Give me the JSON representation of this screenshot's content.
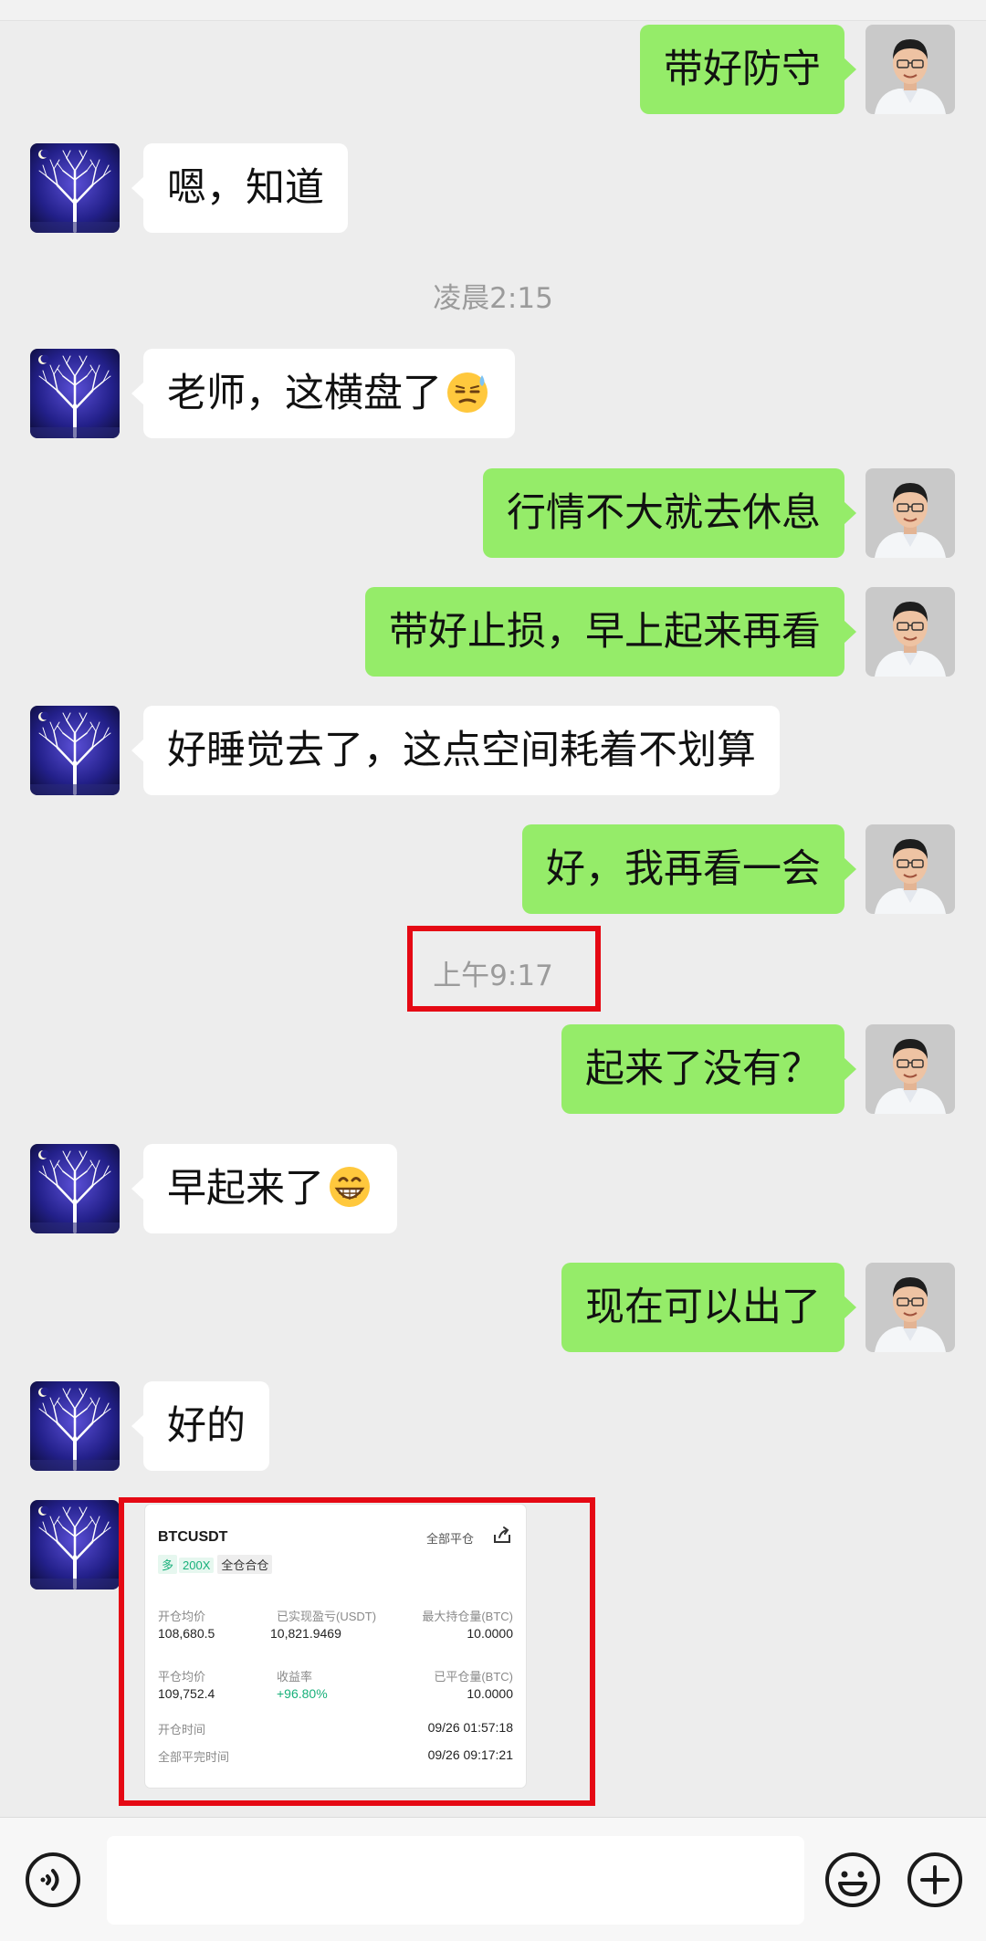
{
  "messages": [
    {
      "side": "right",
      "text": "带好防守"
    },
    {
      "side": "left",
      "text": "嗯，知道"
    },
    {
      "timestamp": "凌晨2:15"
    },
    {
      "side": "left",
      "text": "老师，这横盘了",
      "emoji": "sweat-face-emoji"
    },
    {
      "side": "right",
      "text": "行情不大就去休息"
    },
    {
      "side": "right",
      "text": "带好止损，早上起来再看"
    },
    {
      "side": "left",
      "text": "好睡觉去了，这点空间耗着不划算"
    },
    {
      "side": "right",
      "text": "好，我再看一会"
    },
    {
      "timestamp": "上午9:17"
    },
    {
      "side": "right",
      "text": "起来了没有？"
    },
    {
      "side": "left",
      "text": "早起来了",
      "emoji": "grinning-face-emoji"
    },
    {
      "side": "right",
      "text": "现在可以出了"
    },
    {
      "side": "left",
      "text": "好的"
    }
  ],
  "trade_card": {
    "symbol": "BTCUSDT",
    "close_all": "全部平仓",
    "direction": "多",
    "leverage": "200X",
    "margin_mode": "全仓合仓",
    "open_avg_label": "开仓均价",
    "open_avg_value": "108,680.5",
    "realized_pnl_label": "已实现盈亏(USDT)",
    "realized_pnl_value": "10,821.9469",
    "max_position_label": "最大持仓量(BTC)",
    "max_position_value": "10.0000",
    "close_avg_label": "平仓均价",
    "close_avg_value": "109,752.4",
    "return_label": "收益率",
    "return_value": "+96.80%",
    "closed_qty_label": "已平仓量(BTC)",
    "closed_qty_value": "10.0000",
    "open_time_label": "开仓时间",
    "open_time_value": "09/26 01:57:18",
    "close_time_label": "全部平完时间",
    "close_time_value": "09/26 09:17:21"
  },
  "colors": {
    "sent_bubble": "#95ec69",
    "received_bubble": "#ffffff",
    "background": "#ededed",
    "highlight": "#e50914",
    "profit_green": "#18b07a"
  },
  "input_bar": {
    "left_icon": "voice-icon",
    "right_icons": [
      "emoji-icon",
      "plus-icon"
    ]
  }
}
